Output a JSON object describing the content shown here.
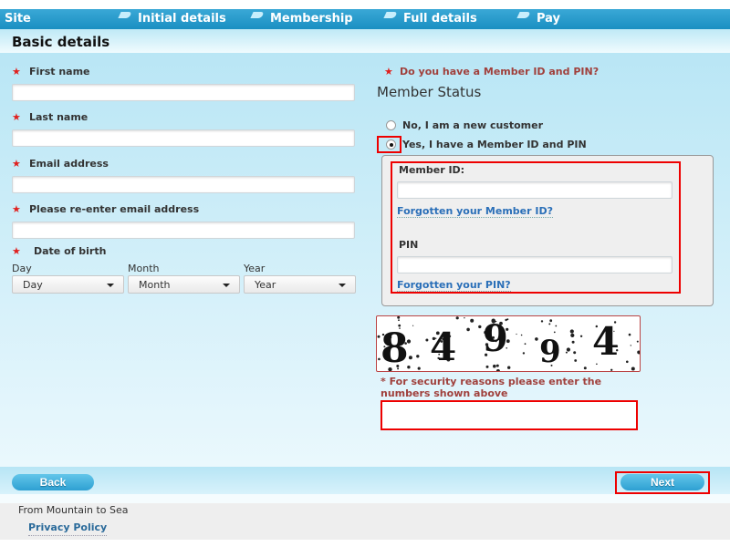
{
  "nav": {
    "site": "Site",
    "steps": [
      "Initial details",
      "Membership",
      "Full details",
      "Pay"
    ]
  },
  "header": {
    "title": "Basic details"
  },
  "form": {
    "first_name_label": "First name",
    "last_name_label": "Last name",
    "email_label": "Email address",
    "reenter_email_label": "Please re-enter email address",
    "dob_label": "Date of birth",
    "day_label": "Day",
    "month_label": "Month",
    "year_label": "Year",
    "day_selected": "Day",
    "month_selected": "Month",
    "year_selected": "Year",
    "required_marker": "★"
  },
  "member": {
    "question": "Do you have a Member ID and PIN?",
    "title": "Member Status",
    "option_no": "No, I am a new customer",
    "option_yes": "Yes, I have a Member ID and PIN",
    "selected": "yes",
    "member_id_label": "Member ID:",
    "forgot_id_link": "Forgotten your Member ID?",
    "pin_label": "PIN",
    "forgot_pin_link": "Forgotten your PIN?"
  },
  "captcha": {
    "digits": [
      "8",
      "4",
      "9",
      "9",
      "4"
    ],
    "instruction": "* For security reasons please enter the numbers shown above"
  },
  "buttons": {
    "back": "Back",
    "next": "Next"
  },
  "footer": {
    "tagline": "From Mountain to Sea",
    "privacy": "Privacy Policy"
  }
}
